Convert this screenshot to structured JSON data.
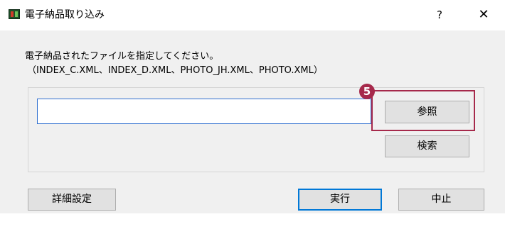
{
  "window": {
    "title": "電子納品取り込み",
    "help_label": "?",
    "close_label": "✕"
  },
  "instruction": {
    "line1": "電子納品されたファイルを指定してください。",
    "line2": "（INDEX_C.XML、INDEX_D.XML、PHOTO_JH.XML、PHOTO.XML）"
  },
  "file_path": {
    "value": "",
    "placeholder": ""
  },
  "buttons": {
    "browse": "参照",
    "search": "検索",
    "detail": "詳細設定",
    "run": "実行",
    "cancel": "中止"
  },
  "annotation": {
    "step_number": "5",
    "color": "#a6294b"
  },
  "colors": {
    "accent": "#0078d7",
    "dialog_bg": "#f0f0f0",
    "button_bg": "#e1e1e1"
  }
}
